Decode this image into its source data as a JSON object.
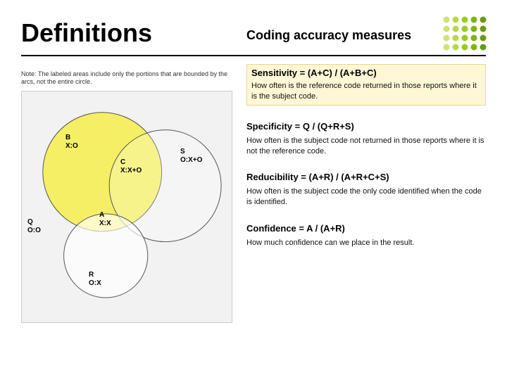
{
  "title": "Definitions",
  "subtitle": "Coding accuracy measures",
  "note": "Note: The labeled areas include only the portions that are bounded by the arcs, not the entire circle.",
  "venn": {
    "labels": {
      "B": "B\nX:O",
      "C": "C\nX:X+O",
      "S": "S\nO:X+O",
      "Q": "Q\nO:O",
      "A": "A\nX:X",
      "R": "R\nO:X"
    }
  },
  "measures": [
    {
      "formula": "Sensitivity = (A+C) / (A+B+C)",
      "desc": "How often is the reference code returned in those reports where it is the subject code.",
      "highlight": true
    },
    {
      "formula": "Specificity = Q / (Q+R+S)",
      "desc": "How often is the subject code not returned in those reports where it is not the reference code.",
      "highlight": false
    },
    {
      "formula": "Reducibility = (A+R) / (A+R+C+S)",
      "desc": "How often is the subject code the only code identified when the code is identified.",
      "highlight": false
    },
    {
      "formula": "Confidence = A / (A+R)",
      "desc": "How much confidence can we place in the result.",
      "highlight": false
    }
  ],
  "dot_colors": [
    "#cfe37a",
    "#b6d94a",
    "#9acb1f",
    "#7fb314",
    "#6a9a12"
  ]
}
